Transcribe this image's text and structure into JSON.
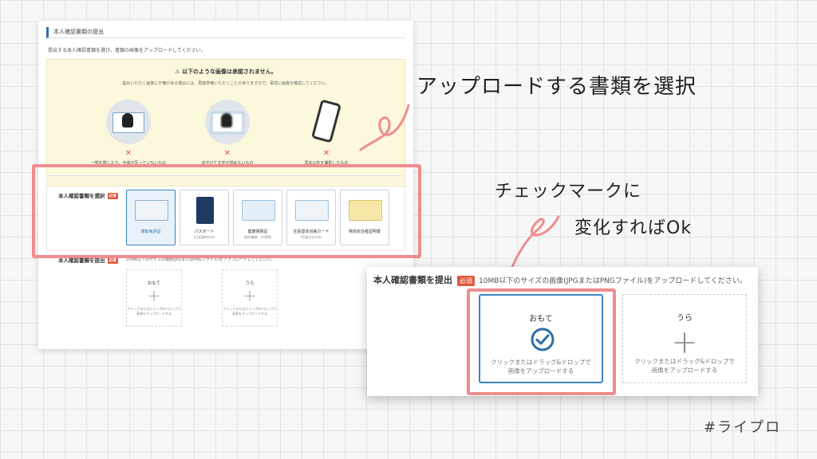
{
  "section": {
    "title": "本人確認書類の提出",
    "intro": "提出する本人確認書類を選び、書類の画像をアップロードしてください。"
  },
  "warning": {
    "title": "以下のような画像は承認されません。",
    "text": "提出いただく画像に不備がある場合には、再度準備いただくことがありますので、事前に画像を確認してください。",
    "items": [
      {
        "caption": "一部を隠したり、全体が写っていないもの"
      },
      {
        "caption": "ぼやけて文字が読めないもの"
      },
      {
        "caption": "原本以外を撮影したもの"
      }
    ]
  },
  "select": {
    "label": "本人確認書類を選択",
    "required": "必須",
    "options": [
      {
        "label": "運転免許証",
        "sub": ""
      },
      {
        "label": "パスポート",
        "sub": "(日本国内のみ)"
      },
      {
        "label": "健康保険証",
        "sub": "(被扶養者・共済等)"
      },
      {
        "label": "住民基本台帳カード",
        "sub": "(写真付きのみ)"
      },
      {
        "label": "特別永住者証明書",
        "sub": ""
      }
    ]
  },
  "upload": {
    "label": "本人確認書類を提出",
    "required": "必須",
    "hint": "10MB以下のサイズの画像(JPGまたはPNGファイル)をアップロードしてください。",
    "front_label": "おもて",
    "back_label": "うら",
    "drop_hint_1": "クリックまたはドラッグ&ドロップで",
    "drop_hint_2": "画像をアップロードする"
  },
  "annotations": {
    "select_doc": "アップロードする書類を選択",
    "check_line1": "チェックマークに",
    "check_line2": "変化すればOk"
  },
  "brand": "#ライプロ",
  "colors": {
    "highlight": "#f08c8e",
    "accent": "#3a85c6",
    "required": "#e0593e"
  }
}
